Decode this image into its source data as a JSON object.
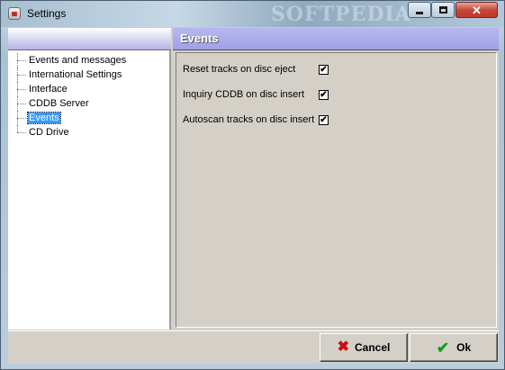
{
  "window": {
    "title": "Settings",
    "watermark": "SOFTPEDIA"
  },
  "tree": {
    "items": [
      {
        "label": "Events and messages",
        "selected": false
      },
      {
        "label": "International Settings",
        "selected": false
      },
      {
        "label": "Interface",
        "selected": false
      },
      {
        "label": "CDDB Server",
        "selected": false
      },
      {
        "label": "Events",
        "selected": true
      },
      {
        "label": "CD Drive",
        "selected": false
      }
    ]
  },
  "page": {
    "title": "Events",
    "options": [
      {
        "label": "Reset tracks on disc eject",
        "checked": true
      },
      {
        "label": "Inquiry CDDB on disc insert",
        "checked": true
      },
      {
        "label": "Autoscan tracks on disc insert",
        "checked": true
      }
    ],
    "check_mark": "✔"
  },
  "buttons": {
    "cancel": "Cancel",
    "ok": "Ok"
  },
  "colors": {
    "selection": "#3399ff",
    "header": "#a0a0e8",
    "cancel_icon": "#c81010",
    "ok_icon": "#1a9a1a"
  }
}
